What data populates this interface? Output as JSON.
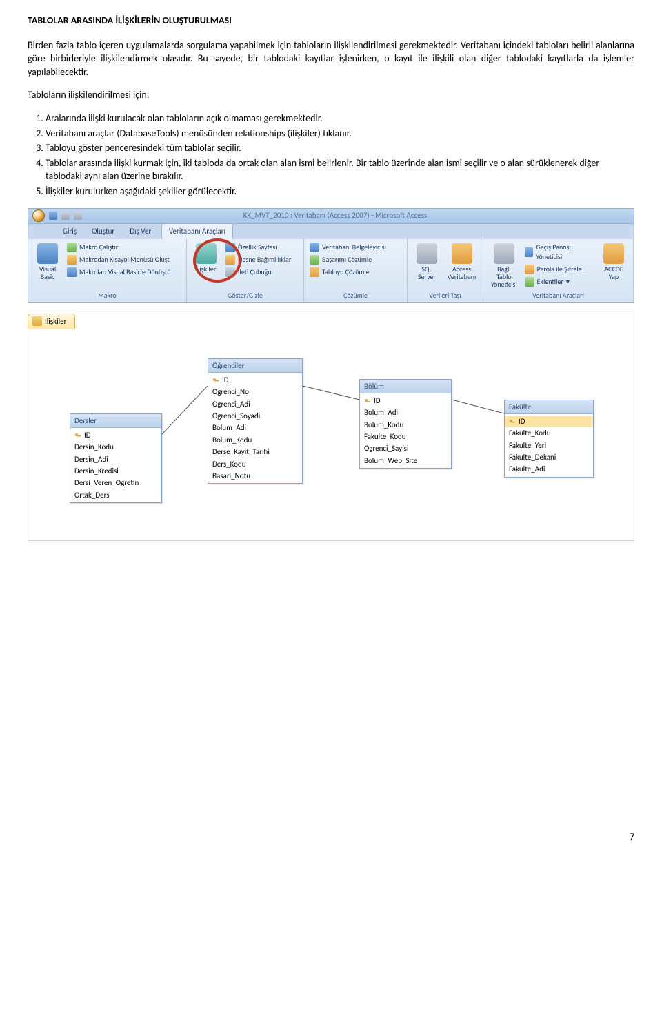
{
  "heading": "TABLOLAR ARASINDA İLİŞKİLERİN OLUŞTURULMASI",
  "para1": "Birden fazla tablo içeren uygulamalarda sorgulama yapabilmek için tabloların ilişkilendirilmesi gerekmektedir. Veritabanı içindeki tabloları belirli alanlarına göre birbirleriyle ilişkilendirmek olasıdır. Bu sayede, bir tablodaki kayıtlar işlenirken, o kayıt ile ilişkili olan diğer tablodaki kayıtlarla da işlemler yapılabilecektir.",
  "para2": "Tabloların ilişkilendirilmesi için;",
  "steps": [
    "Aralarında ilişki kurulacak olan tabloların açık olmaması gerekmektedir.",
    "Veritabanı araçlar (DatabaseTools)  menüsünden relationships (ilişkiler) tıklanır.",
    "Tabloyu göster penceresindeki tüm tablolar seçilir.",
    "Tablolar arasında ilişki kurmak için, iki tabloda da ortak olan alan ismi belirlenir. Bir tablo üzerinde alan ismi seçilir ve o alan sürüklenerek diğer tablodaki aynı alan üzerine bırakılır.",
    "İlişkiler kurulurken aşağıdaki şekiller görülecektir."
  ],
  "ribbon": {
    "windowTitle": "KK_MVT_2010 : Veritabanı (Access 2007) - Microsoft Access",
    "tabs": [
      "Giriş",
      "Oluştur",
      "Dış Veri",
      "Veritabanı Araçları"
    ],
    "activeTab": "Veritabanı Araçları",
    "groups": {
      "g1": {
        "label": "Makro",
        "vb": "Visual\nBasic",
        "items": [
          "Makro Çalıştır",
          "Makrodan Kısayol Menüsü Oluşt",
          "Makroları Visual Basic'e Dönüştü"
        ]
      },
      "g2": {
        "label": "Göster/Gizle",
        "main": "İlişkiler",
        "items": [
          "Özellik Sayfası",
          "Nesne Bağımlılıkları",
          "İleti Çubuğu"
        ]
      },
      "g3": {
        "label": "Çözümle",
        "items": [
          "Veritabanı Belgeleyicisi",
          "Başarımı Çözümle",
          "Tabloyu Çözümle"
        ]
      },
      "g4": {
        "label": "Verileri Taşı",
        "sql": "SQL\nServer",
        "access": "Access\nVeritabanı"
      },
      "g5": {
        "label": "Veritabanı Araçları",
        "linked": "Bağlı Tablo\nYöneticisi",
        "items": [
          "Geçiş Panosu Yöneticisi",
          "Parola ile Şifrele",
          "Eklentiler"
        ],
        "accde": "ACCDE\nYap"
      }
    }
  },
  "rel": {
    "tabLabel": "İlişkiler",
    "tables": {
      "dersler": {
        "title": "Dersler",
        "fields": [
          "ID",
          "Dersin_Kodu",
          "Dersin_Adi",
          "Dersin_Kredisi",
          "Dersi_Veren_Ogretin",
          "Ortak_Ders"
        ]
      },
      "ogrenciler": {
        "title": "Öğrenciler",
        "fields": [
          "ID",
          "Ogrenci_No",
          "Ogrenci_Adi",
          "Ogrenci_Soyadi",
          "Bolum_Adi",
          "Bolum_Kodu",
          "Derse_Kayit_Tarihi",
          "Ders_Kodu",
          "Basari_Notu"
        ]
      },
      "bolum": {
        "title": "Bölüm",
        "fields": [
          "ID",
          "Bolum_Adi",
          "Bolum_Kodu",
          "Fakulte_Kodu",
          "Ogrenci_Sayisi",
          "Bolum_Web_Site"
        ]
      },
      "fakulte": {
        "title": "Fakülte",
        "fields": [
          "ID",
          "Fakulte_Kodu",
          "Fakulte_Yeri",
          "Fakulte_Dekani",
          "Fakulte_Adi"
        ]
      }
    }
  },
  "pageNumber": "7"
}
